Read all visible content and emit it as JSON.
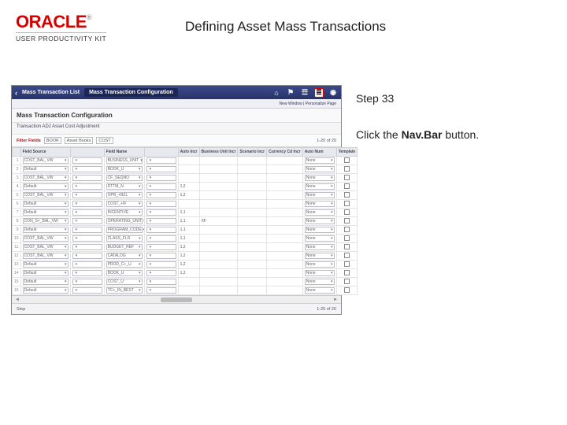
{
  "header": {
    "logo_text": "ORACLE",
    "logo_tm": "®",
    "product_line": "USER PRODUCTIVITY KIT",
    "title": "Defining Asset Mass Transactions"
  },
  "instructions": {
    "step_label": "Step 33",
    "click_prefix": "Click the ",
    "target": "Nav.Bar",
    "click_suffix": " button."
  },
  "shot": {
    "banner": {
      "back_icon": "‹",
      "crumb1": "Mass Transaction List",
      "crumb2": "Mass Transaction Configuration",
      "icons": {
        "home": "⌂",
        "flag": "⚑",
        "bell": "☲",
        "navbar": "≣",
        "gear": "◉"
      }
    },
    "breadcrumb_right": "New Window | Personalize Page",
    "subhead": "Mass Transaction Configuration",
    "transaction_line": "Transaction  ADJ   Asset Cost Adjustment",
    "filter": {
      "label": "Filter Fields",
      "book_lbl": "BOOK",
      "book_val": "Asset Books",
      "cost_lbl": "COST"
    },
    "pager": "1-20 of 20",
    "columns": [
      "",
      "Field Source",
      "",
      "Field Name",
      "",
      "Auto Incr",
      "Business Unit Incr",
      "Scenario Incr",
      "Currency Cd Incr",
      "Auto Num",
      "Template"
    ],
    "rows": [
      {
        "idx": "1",
        "src": "COST_BAL_VW",
        "fn": "BUSINESS_UNIT",
        "ai": "",
        "bu": "",
        "sc": "",
        "cc": "",
        "an": "None",
        "tp": false
      },
      {
        "idx": "2",
        "src": "Default",
        "fn": "BOOK_U",
        "ai": "",
        "bu": "",
        "sc": "",
        "cc": "",
        "an": "None",
        "tp": false
      },
      {
        "idx": "3",
        "src": "COST_BAL_VW",
        "fn": "CF_SEQNO",
        "ai": "",
        "bu": "",
        "sc": "",
        "cc": "",
        "an": "None",
        "tp": false
      },
      {
        "idx": "4",
        "src": "Default",
        "fn": "DTTM_N",
        "ai": "1,2",
        "bu": "",
        "sc": "",
        "cc": "",
        "an": "None",
        "tp": false
      },
      {
        "idx": "5",
        "src": "COST_BAL_VW",
        "fn": "OPR_+BZL",
        "ai": "1,2",
        "bu": "",
        "sc": "",
        "cc": "",
        "an": "None",
        "tp": false
      },
      {
        "idx": "6",
        "src": "Default",
        "fn": "COST_+IF",
        "ai": "",
        "bu": "",
        "sc": "",
        "cc": "",
        "an": "None",
        "tp": false
      },
      {
        "idx": "7",
        "src": "Default",
        "fn": "INCENTIVE",
        "ai": "1,1",
        "bu": "",
        "sc": "",
        "cc": "",
        "an": "None",
        "tp": false
      },
      {
        "idx": "8",
        "src": "CON_S+_BAL_VW",
        "fn": "OPERATING_UNIT",
        "ai": "1,1",
        "bu": "XF",
        "sc": "",
        "cc": "",
        "an": "None",
        "tp": false
      },
      {
        "idx": "9",
        "src": "Default",
        "fn": "PROGRAM_CODE",
        "ai": "1,1",
        "bu": "",
        "sc": "",
        "cc": "",
        "an": "None",
        "tp": false
      },
      {
        "idx": "10",
        "src": "COST_BAL_VW",
        "fn": "CLASS_FLD",
        "ai": "1,1",
        "bu": "",
        "sc": "",
        "cc": "",
        "an": "None",
        "tp": false
      },
      {
        "idx": "11",
        "src": "COST_BAL_VW",
        "fn": "BUDGET_REF",
        "ai": "1,2",
        "bu": "",
        "sc": "",
        "cc": "",
        "an": "None",
        "tp": false
      },
      {
        "idx": "12",
        "src": "COST_BAL_VW",
        "fn": "CATALOG",
        "ai": "1,2",
        "bu": "",
        "sc": "",
        "cc": "",
        "an": "None",
        "tp": false
      },
      {
        "idx": "13",
        "src": "Default",
        "fn": "PROD_C+_U",
        "ai": "1,2",
        "bu": "",
        "sc": "",
        "cc": "",
        "an": "None",
        "tp": false
      },
      {
        "idx": "14",
        "src": "Default",
        "fn": "BOOK_U",
        "ai": "1,2",
        "bu": "",
        "sc": "",
        "cc": "",
        "an": "None",
        "tp": false
      },
      {
        "idx": "15",
        "src": "Default",
        "fn": "COST_U",
        "ai": "",
        "bu": "",
        "sc": "",
        "cc": "",
        "an": "None",
        "tp": false
      },
      {
        "idx": "16",
        "src": "Default",
        "fn": "TC+_IN_BEST",
        "ai": "",
        "bu": "",
        "sc": "",
        "cc": "",
        "an": "None",
        "tp": false
      }
    ],
    "scroll_left": "◄",
    "scroll_right": "►",
    "footer_left": "Step",
    "footer_pager": "1-20 of 20"
  }
}
